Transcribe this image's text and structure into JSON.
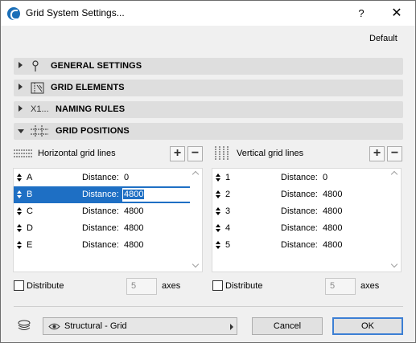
{
  "window": {
    "title": "Grid System Settings...",
    "help_label": "?",
    "close_label": "✕"
  },
  "header": {
    "default_label": "Default"
  },
  "sections": [
    {
      "label": "GENERAL SETTINGS",
      "icon": "pin-icon",
      "expanded": false
    },
    {
      "label": "GRID ELEMENTS",
      "icon": "grid-element-icon",
      "expanded": false
    },
    {
      "label": "NAMING RULES",
      "icon_text": "X1...",
      "expanded": false
    },
    {
      "label": "GRID POSITIONS",
      "icon": "grid-positions-icon",
      "expanded": true
    }
  ],
  "horizontal": {
    "title": "Horizontal grid lines",
    "add_label": "+",
    "remove_label": "−",
    "distance_label": "Distance:",
    "rows": [
      {
        "name": "A",
        "value": "0",
        "selected": false
      },
      {
        "name": "B",
        "value": "4800",
        "selected": true
      },
      {
        "name": "C",
        "value": "4800",
        "selected": false
      },
      {
        "name": "D",
        "value": "4800",
        "selected": false
      },
      {
        "name": "E",
        "value": "4800",
        "selected": false
      }
    ],
    "distribute_label": "Distribute",
    "distribute_checked": false,
    "axes_value": "5",
    "axes_label": "axes"
  },
  "vertical": {
    "title": "Vertical grid lines",
    "add_label": "+",
    "remove_label": "−",
    "distance_label": "Distance:",
    "rows": [
      {
        "name": "1",
        "value": "0",
        "selected": false
      },
      {
        "name": "2",
        "value": "4800",
        "selected": false
      },
      {
        "name": "3",
        "value": "4800",
        "selected": false
      },
      {
        "name": "4",
        "value": "4800",
        "selected": false
      },
      {
        "name": "5",
        "value": "4800",
        "selected": false
      }
    ],
    "distribute_label": "Distribute",
    "distribute_checked": false,
    "axes_value": "5",
    "axes_label": "axes"
  },
  "footer": {
    "layer_value": "Structural - Grid",
    "cancel_label": "Cancel",
    "ok_label": "OK"
  },
  "colors": {
    "selection": "#1e6fc4",
    "section_bg": "#dedede",
    "primary_border": "#3c7fd4"
  }
}
